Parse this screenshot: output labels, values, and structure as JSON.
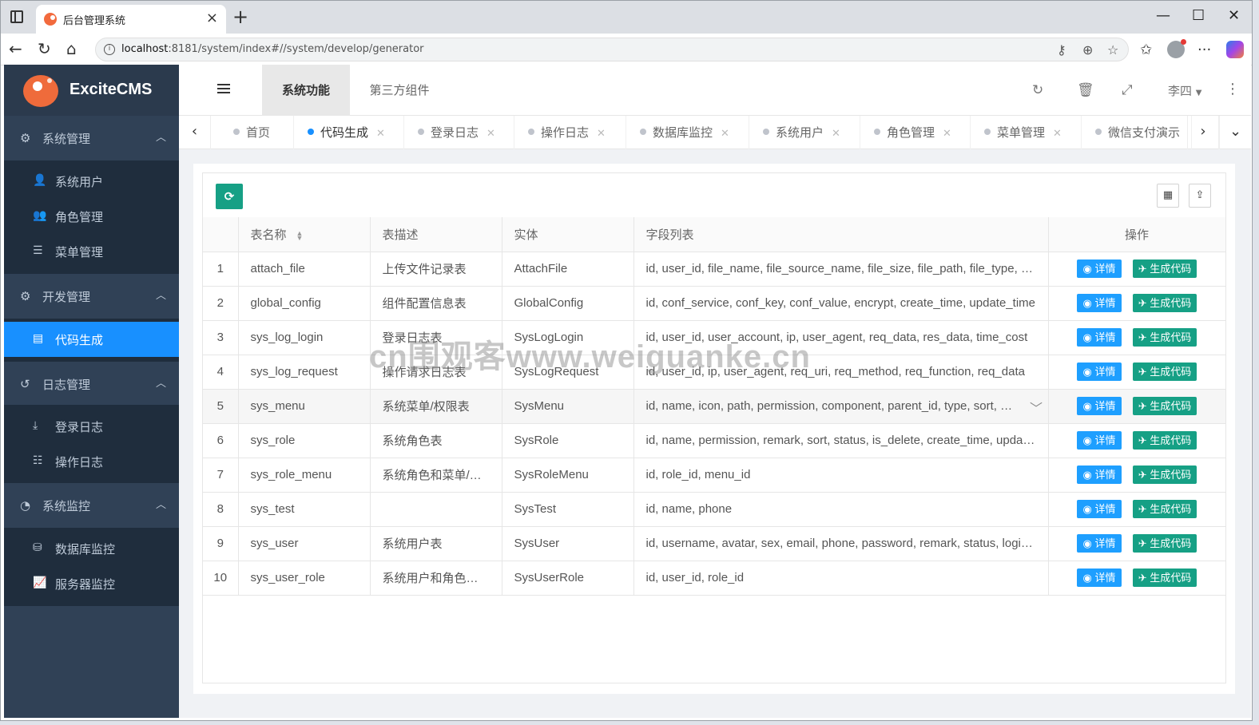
{
  "browser": {
    "tab_title": "后台管理系统",
    "url_host": "localhost",
    "url_rest": ":8181/system/index#//system/develop/generator"
  },
  "app": {
    "brand": "ExciteCMS",
    "sidebar": {
      "groups": [
        {
          "label": "系统管理",
          "icon": "gear-icon",
          "items": [
            {
              "label": "系统用户",
              "icon": "user-icon"
            },
            {
              "label": "角色管理",
              "icon": "users-icon"
            },
            {
              "label": "菜单管理",
              "icon": "list-icon"
            }
          ]
        },
        {
          "label": "开发管理",
          "icon": "cogs-icon",
          "items": [
            {
              "label": "代码生成",
              "icon": "file-code-icon",
              "active": true
            }
          ]
        },
        {
          "label": "日志管理",
          "icon": "history-icon",
          "items": [
            {
              "label": "登录日志",
              "icon": "login-icon"
            },
            {
              "label": "操作日志",
              "icon": "sliders-icon"
            }
          ]
        },
        {
          "label": "系统监控",
          "icon": "dashboard-icon",
          "items": [
            {
              "label": "数据库监控",
              "icon": "database-icon"
            },
            {
              "label": "服务器监控",
              "icon": "line-chart-icon"
            }
          ]
        }
      ]
    },
    "header": {
      "tabs": [
        "系统功能",
        "第三方组件"
      ],
      "user": "李四"
    },
    "page_tags": [
      "首页",
      "代码生成",
      "登录日志",
      "操作日志",
      "数据库监控",
      "系统用户",
      "角色管理",
      "菜单管理",
      "微信支付演示"
    ],
    "table": {
      "columns": [
        "表名称",
        "表描述",
        "实体",
        "字段列表",
        "操作"
      ],
      "detail_label": "详情",
      "generate_label": "生成代码",
      "rows": [
        {
          "no": "1",
          "name": "attach_file",
          "desc": "上传文件记录表",
          "entity": "AttachFile",
          "fields": "id, user_id, file_name, file_source_name, file_size, file_path, file_type, create_time"
        },
        {
          "no": "2",
          "name": "global_config",
          "desc": "组件配置信息表",
          "entity": "GlobalConfig",
          "fields": "id, conf_service, conf_key, conf_value, encrypt, create_time, update_time"
        },
        {
          "no": "3",
          "name": "sys_log_login",
          "desc": "登录日志表",
          "entity": "SysLogLogin",
          "fields": "id, user_id, user_account, ip, user_agent, req_data, res_data, time_cost"
        },
        {
          "no": "4",
          "name": "sys_log_request",
          "desc": "操作请求日志表",
          "entity": "SysLogRequest",
          "fields": "id, user_id, ip, user_agent, req_uri, req_method, req_function, req_data"
        },
        {
          "no": "5",
          "name": "sys_menu",
          "desc": "系统菜单/权限表",
          "entity": "SysMenu",
          "fields": "id, name, icon, path, permission, component, parent_id, type, sort, edit"
        },
        {
          "no": "6",
          "name": "sys_role",
          "desc": "系统角色表",
          "entity": "SysRole",
          "fields": "id, name, permission, remark, sort, status, is_delete, create_time, update_time"
        },
        {
          "no": "7",
          "name": "sys_role_menu",
          "desc": "系统角色和菜单/权限关联表",
          "entity": "SysRoleMenu",
          "fields": "id, role_id, menu_id"
        },
        {
          "no": "8",
          "name": "sys_test",
          "desc": "",
          "entity": "SysTest",
          "fields": "id, name, phone"
        },
        {
          "no": "9",
          "name": "sys_user",
          "desc": "系统用户表",
          "entity": "SysUser",
          "fields": "id, username, avatar, sex, email, phone, password, remark, status, login_time"
        },
        {
          "no": "10",
          "name": "sys_user_role",
          "desc": "系统用户和角色关联表",
          "entity": "SysUserRole",
          "fields": "id, user_id, role_id"
        }
      ]
    }
  },
  "watermark": "cn围观客www.weiguanke.cn",
  "colors": {
    "sidebar": "#304156",
    "submenu": "#1f2d3d",
    "active": "#1890ff",
    "green": "#16a085",
    "blue": "#1e9fff"
  }
}
